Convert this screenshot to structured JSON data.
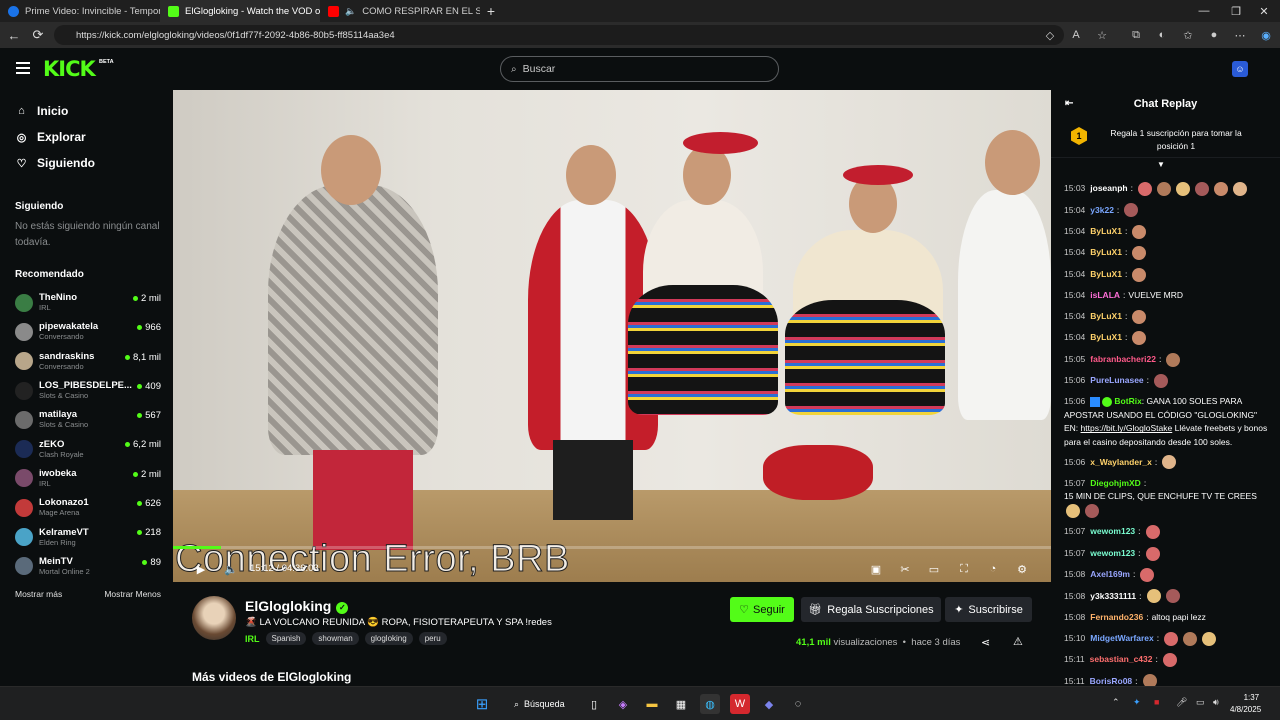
{
  "browser": {
    "tabs": [
      {
        "title": "Prime Video: Invincible - Tempora",
        "icon": "prime-video-icon",
        "color": "#1a73e8"
      },
      {
        "title": "ElGlogloking - Watch the VOD on",
        "icon": "kick-icon",
        "color": "#53fc18"
      },
      {
        "title": "COMO RESPIRAR EN EL SER",
        "icon": "youtube-icon",
        "color": "#ff0000"
      }
    ],
    "url": "https://kick.com/elglogloking/videos/0f1df77f-2092-4b86-80b5-ff85114aa3e4"
  },
  "header": {
    "logo": "KICK",
    "logo_badge": "BETA",
    "search_placeholder": "Buscar"
  },
  "sidebar": {
    "nav": [
      {
        "label": "Inicio",
        "icon": "home-icon"
      },
      {
        "label": "Explorar",
        "icon": "compass-icon"
      },
      {
        "label": "Siguiendo",
        "icon": "heart-icon"
      }
    ],
    "following_title": "Siguiendo",
    "following_empty": "No estás siguiendo ningún canal todavía.",
    "recommended_title": "Recomendado",
    "recommended": [
      {
        "name": "TheNino",
        "category": "IRL",
        "viewers": "2 mil",
        "color": "#3a7d44"
      },
      {
        "name": "pipewakatela",
        "category": "Conversando",
        "viewers": "966",
        "color": "#8a8a8a"
      },
      {
        "name": "sandraskins",
        "category": "Conversando",
        "viewers": "8,1 mil",
        "color": "#b8a68a"
      },
      {
        "name": "LOS_PIBESDELPE...",
        "category": "Slots & Casino",
        "viewers": "409",
        "color": "#222222"
      },
      {
        "name": "matilaya",
        "category": "Slots & Casino",
        "viewers": "567",
        "color": "#6b6b6b"
      },
      {
        "name": "zEKO",
        "category": "Clash Royale",
        "viewers": "6,2 mil",
        "color": "#1b2b55"
      },
      {
        "name": "iwobeka",
        "category": "IRL",
        "viewers": "2 mil",
        "color": "#7a4a6a"
      },
      {
        "name": "Lokonazo1",
        "category": "Mage Arena",
        "viewers": "626",
        "color": "#c23a3a"
      },
      {
        "name": "KelrameVT",
        "category": "Elden Ring",
        "viewers": "218",
        "color": "#4aa3c7"
      },
      {
        "name": "MeinTV",
        "category": "Mortal Online 2",
        "viewers": "89",
        "color": "#5a6a7a"
      }
    ],
    "show_more": "Mostrar más",
    "show_less": "Mostrar Menos"
  },
  "player": {
    "overlay_text": "Connection Error, BRB",
    "time": "15:12 / 04:36:03",
    "progress": 0.055
  },
  "channel": {
    "name": "ElGlogloking",
    "title": "🌋 LA VOLCANO REUNIDA 😎 ROPA, FISIOTERAPEUTA Y SPA !redes",
    "category": "IRL",
    "tags": [
      "Spanish",
      "showman",
      "glogloking",
      "peru"
    ],
    "follow_label": "Seguir",
    "gift_label": "Regala Suscripciones",
    "subscribe_label": "Suscribirse",
    "views_count": "41,1 mil",
    "views_suffix": "visualizaciones",
    "ago": "hace 3 días",
    "more_videos": "Más videos de ElGlogloking"
  },
  "chat": {
    "title": "Chat Replay",
    "gift_badge": "1",
    "gift_text": "Regala 1 suscripción para tomar la posición 1",
    "messages": [
      {
        "time": "15:03",
        "user": "joseanph",
        "color": "#ffffff",
        "text": "",
        "emotes": 6
      },
      {
        "time": "15:04",
        "user": "y3k22",
        "color": "#7aa7ff",
        "text": "",
        "emotes": 1
      },
      {
        "time": "15:04",
        "user": "ByLuX1",
        "color": "#ffd26b",
        "text": "",
        "emotes": 1
      },
      {
        "time": "15:04",
        "user": "ByLuX1",
        "color": "#ffd26b",
        "text": "",
        "emotes": 1
      },
      {
        "time": "15:04",
        "user": "ByLuX1",
        "color": "#ffd26b",
        "text": "",
        "emotes": 1
      },
      {
        "time": "15:04",
        "user": "isLALA",
        "color": "#ff6fd8",
        "text": "VUELVE MRD",
        "emotes": 0
      },
      {
        "time": "15:04",
        "user": "ByLuX1",
        "color": "#ffd26b",
        "text": "",
        "emotes": 1
      },
      {
        "time": "15:04",
        "user": "ByLuX1",
        "color": "#ffd26b",
        "text": "",
        "emotes": 1
      },
      {
        "time": "15:05",
        "user": "fabranbacheri22",
        "color": "#ff5a8a",
        "text": "",
        "emotes": 1
      },
      {
        "time": "15:06",
        "user": "PureLunasee",
        "color": "#9aa7ff",
        "text": "",
        "emotes": 1
      }
    ],
    "bot_message": {
      "time": "15:06",
      "user": "BotRix",
      "color": "#53fc18",
      "text": "GANA 100 SOLES PARA APOSTAR USANDO EL CÓDIGO \"GLOGLOKING\" EN:",
      "link": "https://bit.ly/GlogloStake",
      "text2": "Llévate freebets y bonos para el casino depositando desde 100 soles."
    },
    "messages2": [
      {
        "time": "15:06",
        "user": "x_Waylander_x",
        "color": "#ffd26b",
        "text": "",
        "emotes": 1
      },
      {
        "time": "15:07",
        "user": "DiegohjmXD",
        "color": "#53fc18",
        "text": "15 MIN DE CLIPS, QUE ENCHUFE TV TE CREES",
        "emotes": 2
      },
      {
        "time": "15:07",
        "user": "wewom123",
        "color": "#7afcd0",
        "text": "",
        "emotes": 1
      },
      {
        "time": "15:07",
        "user": "wewom123",
        "color": "#7afcd0",
        "text": "",
        "emotes": 1
      },
      {
        "time": "15:08",
        "user": "Axel169m",
        "color": "#9aa7ff",
        "text": "",
        "emotes": 1
      },
      {
        "time": "15:08",
        "user": "y3k3331111",
        "color": "#ffffff",
        "text": "",
        "emotes": 2
      },
      {
        "time": "15:08",
        "user": "Fernando236",
        "color": "#ffb36b",
        "text": "altoq papi lezz",
        "emotes": 0
      },
      {
        "time": "15:10",
        "user": "MidgetWarfarex",
        "color": "#7aa7ff",
        "text": "",
        "emotes": 3
      },
      {
        "time": "15:11",
        "user": "sebastian_c432",
        "color": "#ff6f6f",
        "text": "",
        "emotes": 1
      },
      {
        "time": "15:11",
        "user": "BorisRo08",
        "color": "#9aa7ff",
        "text": "",
        "emotes": 1
      }
    ]
  },
  "taskbar": {
    "search_label": "Búsqueda",
    "time": "1:37",
    "date": "4/8/2025"
  }
}
